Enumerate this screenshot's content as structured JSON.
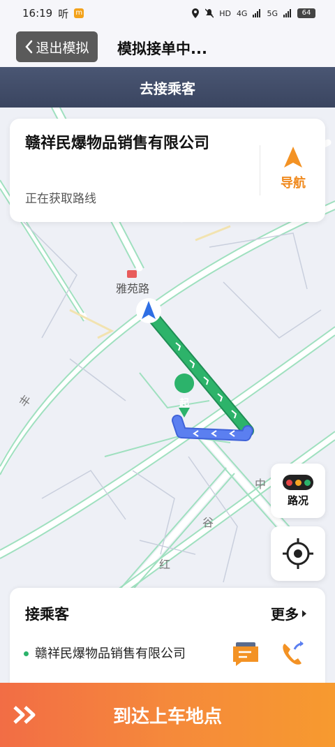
{
  "status_bar": {
    "time": "16:19",
    "notif_text": "听",
    "app_badge": "m",
    "network_1": "HD",
    "network_2": "4G",
    "network_3": "5G",
    "battery": "64"
  },
  "header": {
    "back_label": "退出模拟",
    "title": "模拟接单中..."
  },
  "subheader": {
    "title": "去接乘客"
  },
  "destination_card": {
    "name": "赣祥民爆物品销售有限公司",
    "status": "正在获取路线",
    "nav_label": "导航"
  },
  "map": {
    "road_label_1": "雅苑路",
    "road_label_2": "丰",
    "road_label_3": "中",
    "road_label_4": "谷",
    "road_label_5": "红",
    "start_marker": "起",
    "route_color": "#2db36a",
    "route_blue": "#5b7ff0"
  },
  "map_controls": {
    "traffic_label": "路况",
    "locate_icon": "crosshair-icon"
  },
  "passenger_card": {
    "title": "接乘客",
    "more_label": "更多",
    "destination": "赣祥民爆物品销售有限公司"
  },
  "action": {
    "arrive_label": "到达上车地点"
  },
  "colors": {
    "accent": "#f08a1e",
    "header_bg": "#3f4a66"
  }
}
